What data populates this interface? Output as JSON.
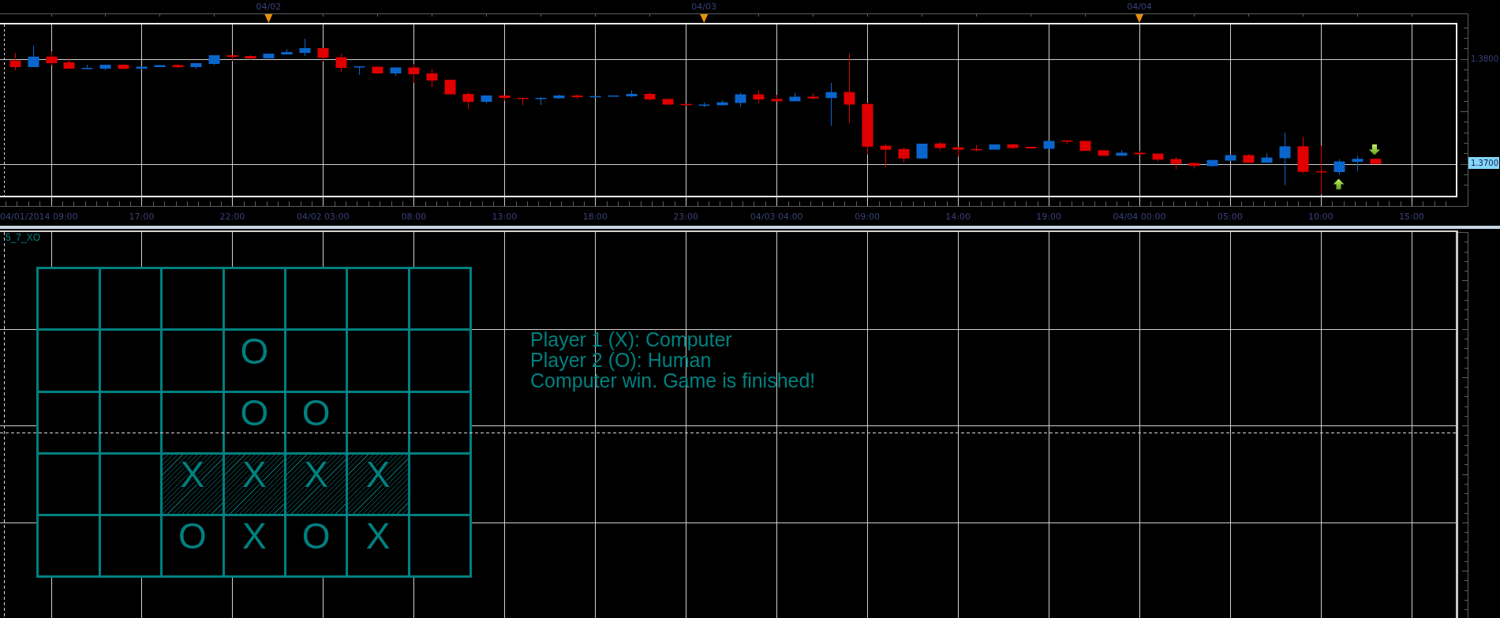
{
  "price_chart": {
    "date_markers": [
      "04/02",
      "04/03",
      "04/04"
    ],
    "price_labels": [
      {
        "text": "1.3800",
        "highlighted": false
      },
      {
        "text": "1.3700",
        "highlighted": true
      }
    ],
    "time_labels": [
      "04/01/2014 09:00",
      "17:00",
      "22:00",
      "04/02 03:00",
      "08:00",
      "13:00",
      "18:00",
      "23:00",
      "04/03 04:00",
      "09:00",
      "14:00",
      "19:00",
      "04/04 00:00",
      "05:00",
      "10:00",
      "15:00"
    ]
  },
  "indicator_panel": {
    "title": "5_7_XO",
    "board": {
      "rows": [
        [
          {
            "winning": false
          },
          {
            "winning": false
          },
          {
            "winning": false
          },
          {
            "winning": false
          },
          {
            "winning": false
          },
          {
            "winning": false
          },
          {
            "winning": false
          }
        ],
        [
          {
            "winning": false
          },
          {
            "winning": false
          },
          {
            "winning": false
          },
          {
            "mark": "O",
            "winning": false
          },
          {
            "winning": false
          },
          {
            "winning": false
          },
          {
            "winning": false
          }
        ],
        [
          {
            "winning": false
          },
          {
            "winning": false
          },
          {
            "winning": false
          },
          {
            "mark": "O",
            "winning": false
          },
          {
            "mark": "O",
            "winning": false
          },
          {
            "winning": false
          },
          {
            "winning": false
          }
        ],
        [
          {
            "winning": false
          },
          {
            "winning": false
          },
          {
            "mark": "X",
            "winning": true
          },
          {
            "mark": "X",
            "winning": true
          },
          {
            "mark": "X",
            "winning": true
          },
          {
            "mark": "X",
            "winning": true
          },
          {
            "winning": false
          }
        ],
        [
          {
            "winning": false
          },
          {
            "winning": false
          },
          {
            "mark": "O",
            "winning": false
          },
          {
            "mark": "X",
            "winning": false
          },
          {
            "mark": "O",
            "winning": false
          },
          {
            "mark": "X",
            "winning": false
          },
          {
            "winning": false
          }
        ]
      ]
    },
    "status_lines": [
      "Player 1 (X): Computer",
      "Player 2 (O): Human",
      "Computer win. Game is finished!"
    ]
  }
}
